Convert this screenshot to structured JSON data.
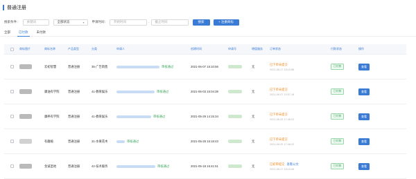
{
  "page": {
    "title": "普通注册"
  },
  "filters": {
    "search_label": "搜索条件：",
    "name_placeholder": "关键词",
    "status_value": "全部状态",
    "apply_time_label": "申请时间：",
    "start_placeholder": "开始时间",
    "end_placeholder": "截止时间",
    "separator": "-",
    "search_btn": "搜索",
    "register_btn": "+ 注册商标"
  },
  "tabs": [
    {
      "label": "全部",
      "active": false
    },
    {
      "label": "已付款",
      "active": true
    },
    {
      "label": "未付款",
      "active": false
    }
  ],
  "table": {
    "headers": [
      "商标图片",
      "商标名称",
      "产品类型",
      "分类",
      "申请人",
      "创建时间",
      "申请号",
      "增值服务",
      "订单状态",
      "付款状态",
      "操作"
    ],
    "rows": [
      {
        "name": "云初智慧",
        "product": "普通注册",
        "category": "35-广告销售",
        "applicant_status": "审核通过",
        "created": "2021-06-07 15:10:56",
        "service": "无",
        "order_status": "已下单未提交",
        "order_date": "2021-06-17 15:10:56",
        "order_link": "",
        "pay_status": "已付款",
        "action": "查看",
        "img": "dark"
      },
      {
        "name": "康油有学院",
        "product": "普通注册",
        "category": "41-教育娱乐",
        "applicant_status": "审核通过",
        "created": "2021-06-03 15:04:39",
        "service": "无",
        "order_status": "已下单未提交",
        "order_date": "2021-06-07 10:57:18",
        "order_link": "",
        "pay_status": "已付款",
        "action": "查看",
        "img": "dark"
      },
      {
        "name": "康养有学院",
        "product": "普通注册",
        "category": "41-教育娱乐",
        "applicant_status": "审核通过",
        "created": "2021-05-29 14:15:34",
        "service": "无",
        "order_status": "已下单未提交",
        "order_date": "2021-06-02 17:46:22",
        "order_link": "",
        "pay_status": "已付款",
        "action": "查看",
        "img": "dark"
      },
      {
        "name": "有趣植",
        "product": "普通注册",
        "category": "31-水果花木",
        "applicant_status": "审核通过",
        "created": "2021-05-28 16:18:43",
        "service": "无",
        "order_status": "已下单未提交",
        "order_date": "2021-06-02 17:46:22",
        "order_link": "",
        "pay_status": "已付款",
        "action": "查看",
        "img": "soft"
      },
      {
        "name": "金诚圣地",
        "product": "普通注册",
        "category": "42-技术服务",
        "applicant_status": "审核通过",
        "created": "2021-05-18 16:41:51",
        "service": "无",
        "order_status": "已初审提交",
        "order_date": "2021-06-17 15:10:46",
        "order_link": "查看公文",
        "pay_status": "已付款",
        "action": "查看",
        "img": "dark"
      }
    ]
  },
  "colors": {
    "accent": "#3a7bd5",
    "success": "#3aa55a",
    "warning": "#f08a24"
  },
  "icons": {
    "status_chevron": "chevron-down-icon"
  }
}
